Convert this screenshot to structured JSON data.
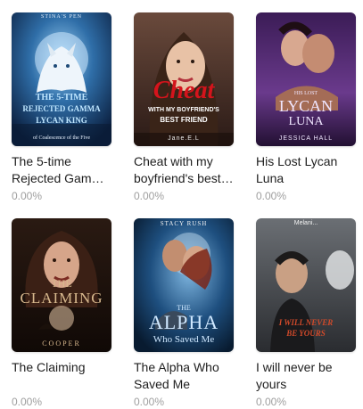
{
  "books": [
    {
      "title": "The 5-time Rejected Gamma Lycan King",
      "progress": "0.00%",
      "cover": {
        "author": "STINA'S PEN",
        "line1": "THE 5-TIME",
        "line2": "REJECTED GAMMA",
        "line3": "LYCAN KING",
        "series": "of Coalescence of the Five"
      }
    },
    {
      "title": "Cheat with my boyfriend's best friend",
      "progress": "0.00%",
      "cover": {
        "headline": "Cheat",
        "sub1": "WITH MY BOYFRIEND'S",
        "sub2": "BEST FRIEND",
        "author": "Jane.E.L"
      }
    },
    {
      "title": "His Lost Lycan Luna",
      "progress": "0.00%",
      "cover": {
        "his_lost": "HIS LOST",
        "lycan": "LYCAN",
        "luna": "LUNA",
        "author": "JESSICA HALL"
      }
    },
    {
      "title": "The Claiming",
      "progress": "0.00%",
      "cover": {
        "the": "THE",
        "claiming": "CLAIMING",
        "author": "COOPER"
      }
    },
    {
      "title": "The Alpha Who Saved Me",
      "progress": "0.00%",
      "cover": {
        "author": "STACY RUSH",
        "the": "THE",
        "alpha": "ALPHA",
        "who_saved": "Who Saved Me"
      }
    },
    {
      "title": "I will never be yours",
      "progress": "0.00%",
      "cover": {
        "author": "Melani...",
        "line1": "I WILL NEVER",
        "line2": "BE YOURS"
      }
    }
  ]
}
